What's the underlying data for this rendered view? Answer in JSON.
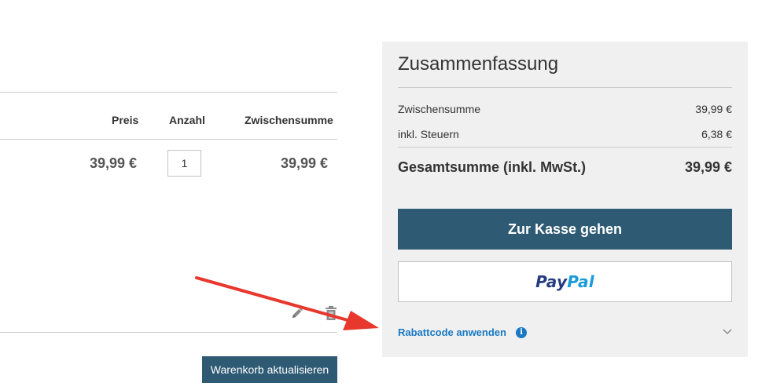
{
  "cart": {
    "columns": {
      "price": "Preis",
      "qty": "Anzahl",
      "subtotal": "Zwischensumme"
    },
    "item": {
      "price": "39,99 €",
      "qty": "1",
      "subtotal": "39,99 €"
    },
    "icons": {
      "edit": "pencil-icon",
      "delete": "trash-icon"
    },
    "update_label": "Warenkorb aktualisieren"
  },
  "summary": {
    "title": "Zusammenfassung",
    "rows": [
      {
        "label": "Zwischensumme",
        "value": "39,99 €"
      },
      {
        "label": "inkl. Steuern",
        "value": "6,38 €"
      }
    ],
    "total": {
      "label": "Gesamtsumme (inkl. MwSt.)",
      "value": "39,99 €"
    },
    "checkout_label": "Zur Kasse gehen",
    "paypal": {
      "pay": "Pay",
      "pal": "Pal"
    },
    "coupon": {
      "label": "Rabattcode anwenden",
      "info_glyph": "i"
    }
  },
  "colors": {
    "primary_button": "#2e5a74",
    "link": "#1979c3",
    "panel_bg": "#f0f0f0",
    "annotation_arrow": "#e8372c",
    "paypal_dark": "#253b80",
    "paypal_light": "#179bd7"
  }
}
